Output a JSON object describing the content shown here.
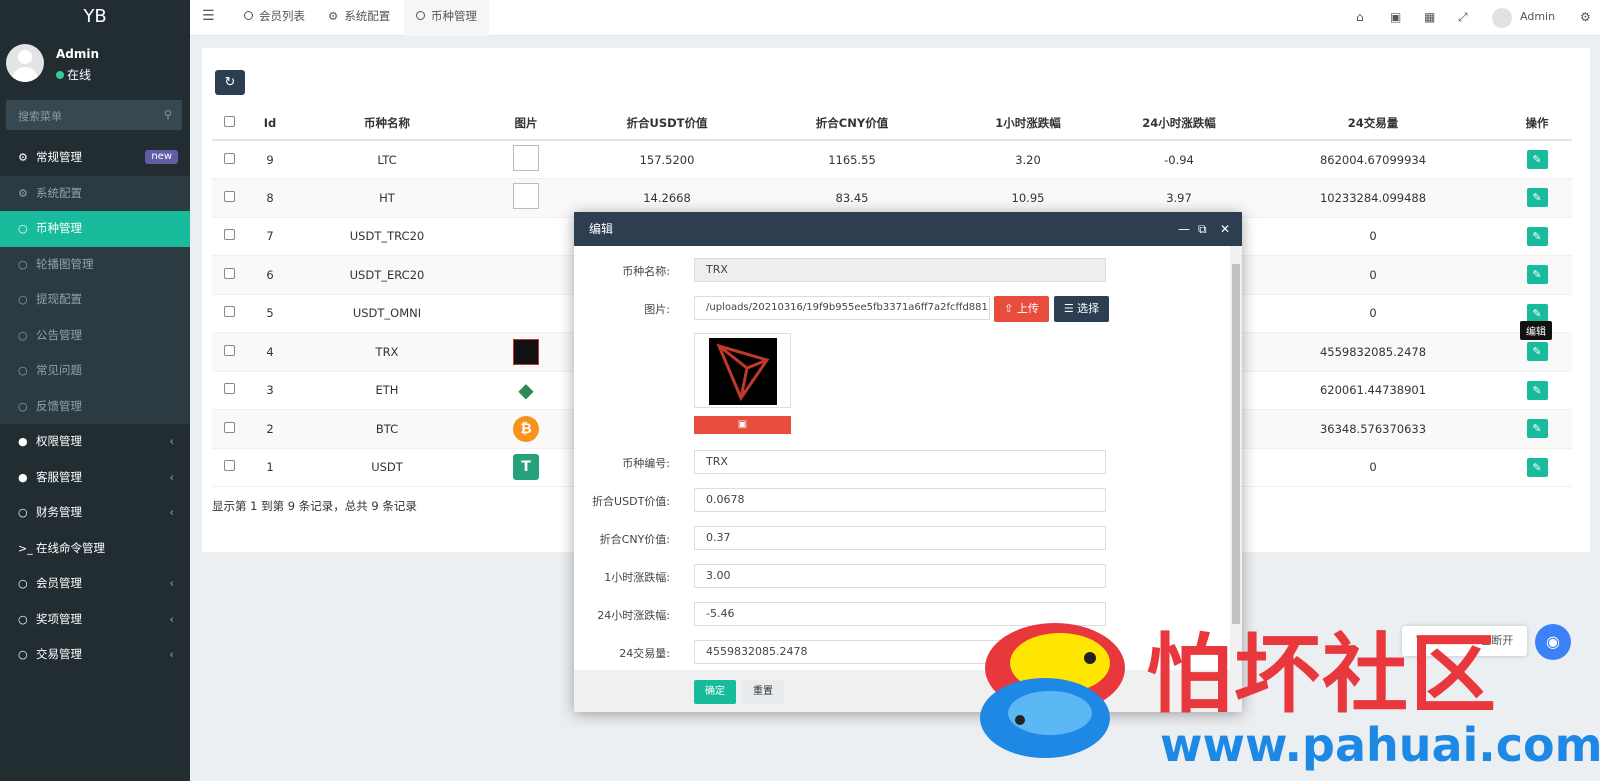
{
  "brand": "YB",
  "user": {
    "name": "Admin",
    "status": "在线"
  },
  "sidebar": {
    "search_placeholder": "搜索菜单",
    "items": [
      {
        "icon": "cogs-icon",
        "label": "常规管理",
        "badge": "new"
      },
      {
        "icon": "cog-icon",
        "label": "系统配置"
      },
      {
        "icon": "circle-icon",
        "label": "币种管理"
      },
      {
        "icon": "circle-icon",
        "label": "轮播图管理"
      },
      {
        "icon": "circle-icon",
        "label": "提现配置"
      },
      {
        "icon": "circle-icon",
        "label": "公告管理"
      },
      {
        "icon": "circle-icon",
        "label": "常见问题"
      },
      {
        "icon": "circle-icon",
        "label": "反馈管理"
      },
      {
        "icon": "users-icon",
        "label": "权限管理"
      },
      {
        "icon": "comment-icon",
        "label": "客服管理"
      },
      {
        "icon": "circle-icon",
        "label": "财务管理"
      },
      {
        "icon": "terminal-icon",
        "label": "在线命令管理"
      },
      {
        "icon": "circle-icon",
        "label": "会员管理"
      },
      {
        "icon": "circle-icon",
        "label": "奖项管理"
      },
      {
        "icon": "circle-icon",
        "label": "交易管理"
      }
    ]
  },
  "topbar": {
    "tabs": [
      "会员列表",
      "系统配置",
      "币种管理"
    ],
    "user_name": "Admin",
    "icons": [
      "home-icon",
      "trash-icon",
      "translate-icon",
      "fullscreen-icon",
      "cogs-icon"
    ]
  },
  "table": {
    "headers": [
      "Id",
      "币种名称",
      "图片",
      "折合USDT价值",
      "折合CNY价值",
      "1小时涨跌幅",
      "24小时涨跌幅",
      "24交易量",
      "操作"
    ],
    "rows": [
      {
        "id": "9",
        "name": "LTC",
        "img": "broken",
        "usdt": "157.5200",
        "cny": "1165.55",
        "h1": "3.20",
        "h24": "-0.94",
        "vol": "862004.67099934"
      },
      {
        "id": "8",
        "name": "HT",
        "img": "broken",
        "usdt": "14.2668",
        "cny": "83.45",
        "h1": "10.95",
        "h24": "3.97",
        "vol": "10233284.099488"
      },
      {
        "id": "7",
        "name": "USDT_TRC20",
        "img": "",
        "usdt": "",
        "cny": "",
        "h1": "",
        "h24": "",
        "vol": "0"
      },
      {
        "id": "6",
        "name": "USDT_ERC20",
        "img": "",
        "usdt": "",
        "cny": "",
        "h1": "",
        "h24": "",
        "vol": "0"
      },
      {
        "id": "5",
        "name": "USDT_OMNI",
        "img": "",
        "usdt": "",
        "cny": "",
        "h1": "",
        "h24": "",
        "vol": "0"
      },
      {
        "id": "4",
        "name": "TRX",
        "img": "trx",
        "usdt": "",
        "cny": "",
        "h1": "",
        "h24": "",
        "vol": "4559832085.2478"
      },
      {
        "id": "3",
        "name": "ETH",
        "img": "eth",
        "usdt": "",
        "cny": "",
        "h1": "",
        "h24": "",
        "vol": "620061.44738901"
      },
      {
        "id": "2",
        "name": "BTC",
        "img": "btc",
        "usdt": "",
        "cny": "",
        "h1": "",
        "h24": "",
        "vol": "36348.576370633"
      },
      {
        "id": "1",
        "name": "USDT",
        "img": "usdt",
        "usdt": "",
        "cny": "",
        "h1": "",
        "h24": "",
        "vol": "0"
      }
    ],
    "pager_text": "显示第 1 到第 9 条记录，总共 9 条记录"
  },
  "tooltip": "编辑",
  "ws_text": "WebSocket 已断开",
  "dialog": {
    "title": "编辑",
    "fields": {
      "name_label": "币种名称:",
      "name_value": "TRX",
      "image_label": "图片:",
      "image_value": "/uploads/20210316/19f9b955ee5fb3371a6ff7a2fcffd881.jpg",
      "upload_label": "上传",
      "select_label": "选择",
      "code_label": "币种编号:",
      "code_value": "TRX",
      "usdt_label": "折合USDT价值:",
      "usdt_value": "0.0678",
      "cny_label": "折合CNY价值:",
      "cny_value": "0.37",
      "h1_label": "1小时涨跌幅:",
      "h1_value": "3.00",
      "h24_label": "24小时涨跌幅:",
      "h24_value": "-5.46",
      "vol_label": "24交易量:",
      "vol_value": "4559832085.2478"
    },
    "ok_label": "确定",
    "reset_label": "重置"
  },
  "watermark": {
    "text": "怕坏社区",
    "url": "www.pahuai.com"
  }
}
